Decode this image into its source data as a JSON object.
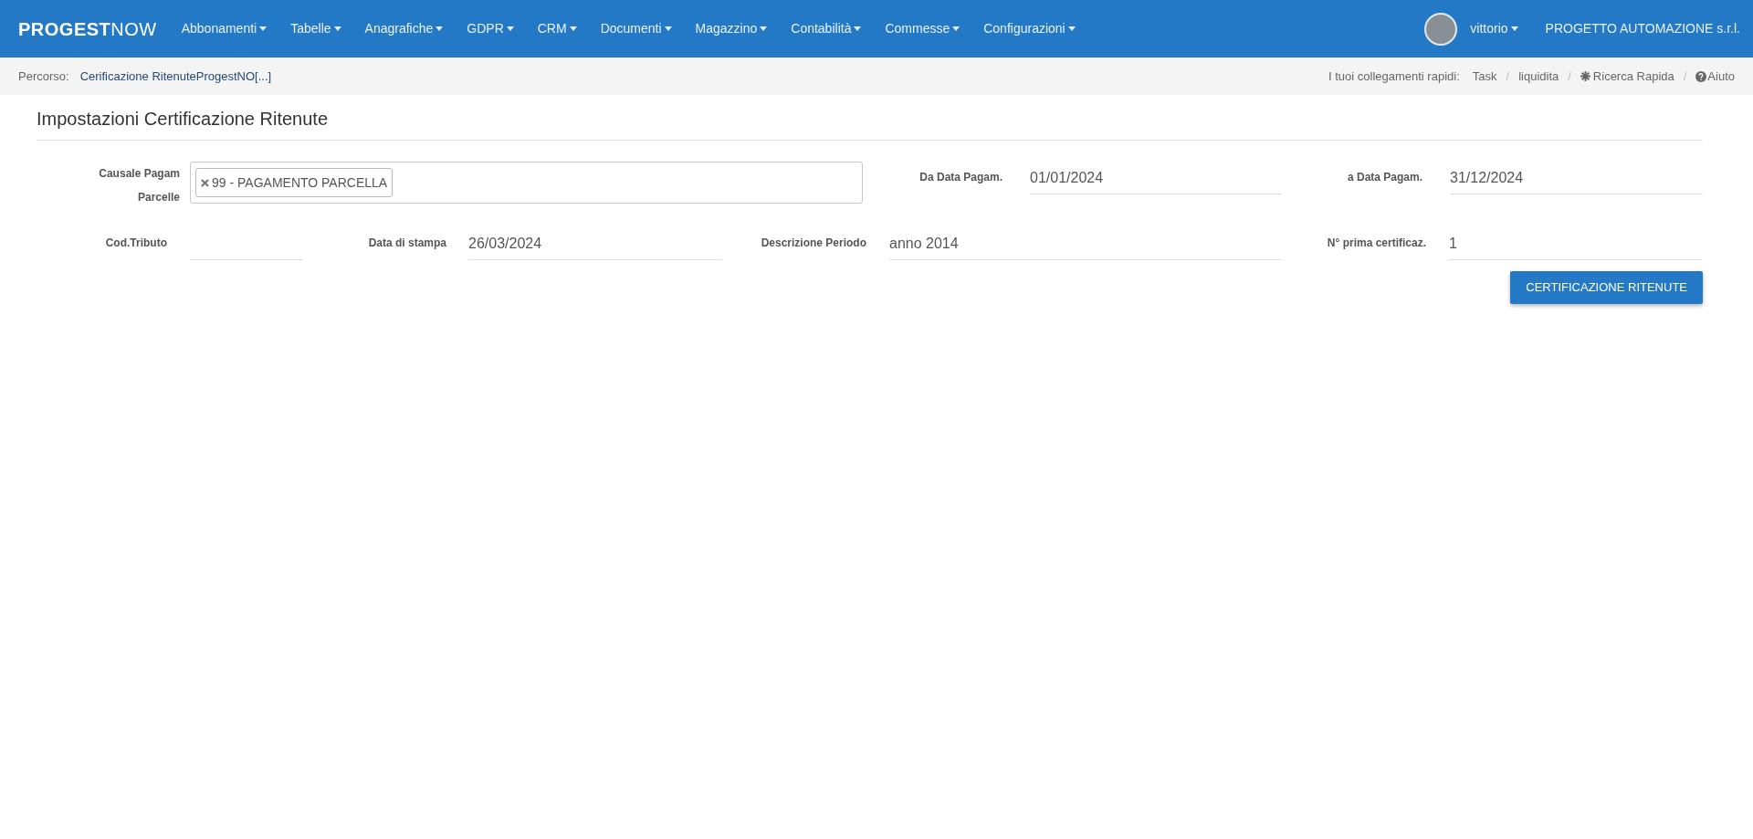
{
  "navbar": {
    "brand_bold": "PROGEST",
    "brand_light": "NOW",
    "menu": [
      {
        "label": "Abbonamenti"
      },
      {
        "label": "Tabelle"
      },
      {
        "label": "Anagrafiche"
      },
      {
        "label": "GDPR"
      },
      {
        "label": "CRM"
      },
      {
        "label": "Documenti"
      },
      {
        "label": "Magazzino"
      },
      {
        "label": "Contabilità"
      },
      {
        "label": "Commesse"
      },
      {
        "label": "Configurazioni"
      }
    ],
    "user": "vittorio",
    "company": "PROGETTO AUTOMAZIONE s.r.l."
  },
  "breadcrumb": {
    "label": "Percorso:",
    "path": "Cerificazione RitenuteProgestNO[...]",
    "quick_links_label": "I tuoi collegamenti rapidi:",
    "separator": "/",
    "quick_links": [
      {
        "kind": "plain",
        "label": "Task"
      },
      {
        "kind": "plain",
        "label": "liquidita"
      },
      {
        "kind": "search",
        "label": "Ricerca Rapida"
      },
      {
        "kind": "help",
        "label": "Aiuto"
      }
    ]
  },
  "title": "Impostazioni Certificazione Ritenute",
  "form": {
    "row_1": [
      {
        "kind": "tags",
        "label": "Causale Pagam Parcelle",
        "tags": [
          "99 - PAGAMENTO PARCELLA"
        ]
      },
      {
        "kind": "text",
        "label": "Da Data Pagam.",
        "value": "01/01/2024"
      },
      {
        "kind": "text",
        "label": "a Data Pagam.",
        "value": "31/12/2024"
      }
    ],
    "row_2": [
      {
        "kind": "text",
        "label": "Cod.Tributo"
      },
      {
        "kind": "text",
        "label": "Data di stampa",
        "value": "26/03/2024"
      },
      {
        "kind": "text",
        "label": "Descrizione Periodo",
        "value": "anno 2014"
      },
      {
        "kind": "text",
        "label": "N° prima certificaz.",
        "value": "1"
      }
    ],
    "submit": "CERTIFICAZIONE RITENUTE"
  }
}
